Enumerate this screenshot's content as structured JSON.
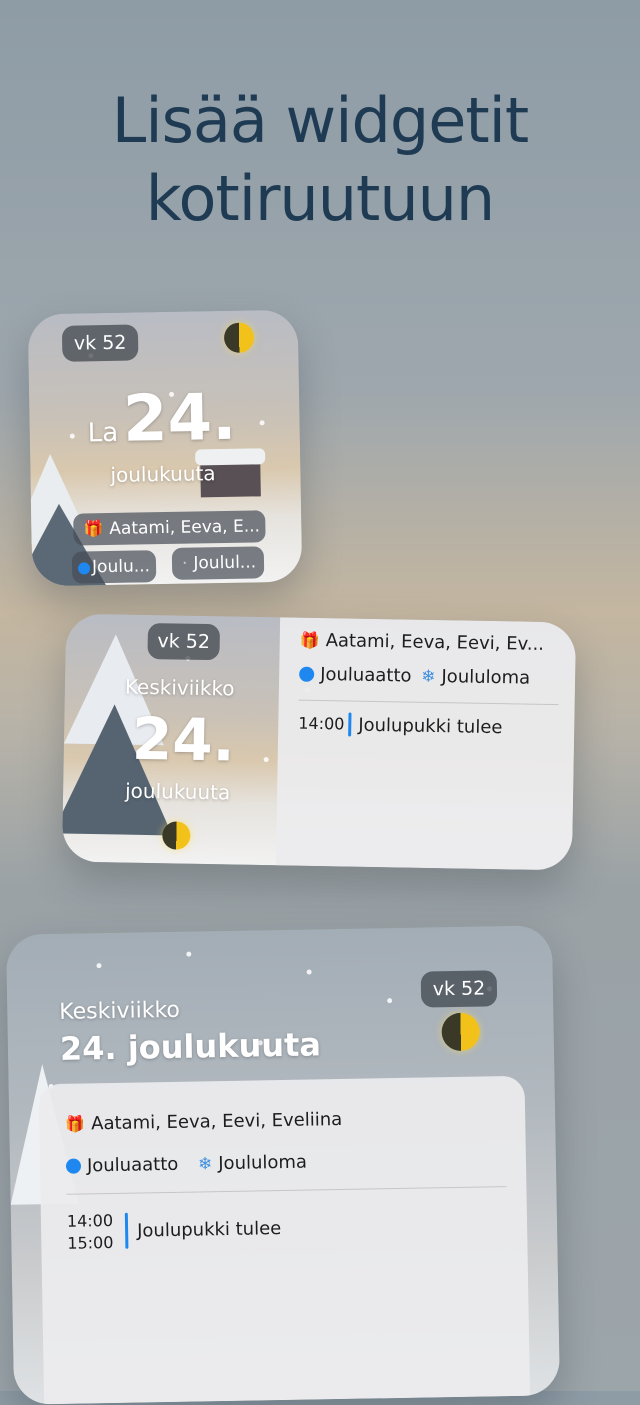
{
  "headline": {
    "line1": "Lisää widgetit",
    "line2": "kotiruutuun"
  },
  "small_widget": {
    "week": "vk 52",
    "weekday": "La",
    "day": "24.",
    "month": "joulukuuta",
    "names": "Aatami, Eeva, E...",
    "chip1": "Joulu...",
    "chip2": "Joulul..."
  },
  "medium_widget": {
    "week": "vk 52",
    "weekday": "Keskiviikko",
    "day": "24.",
    "month": "joulukuuta",
    "names": "Aatami, Eeva, Eevi, Ev...",
    "holiday1": "Jouluaatto",
    "holiday2": "Joululoma",
    "event_time": "14:00",
    "event_title": "Joulupukki tulee"
  },
  "large_widget": {
    "week": "vk 52",
    "weekday": "Keskiviikko",
    "date": "24. joulukuuta",
    "names": "Aatami, Eeva, Eevi, Eveliina",
    "holiday1": "Jouluaatto",
    "holiday2": "Joululoma",
    "event_start": "14:00",
    "event_end": "15:00",
    "event_title": "Joulupukki tulee"
  },
  "icons": {
    "gift": "gift-icon",
    "dot": "blue-dot-icon",
    "snowflake": "snowflake-icon",
    "moon": "half-moon-icon"
  },
  "colors": {
    "headline": "#1f3b53",
    "event_accent": "#1e88f0",
    "moon": "#f2c21a"
  }
}
